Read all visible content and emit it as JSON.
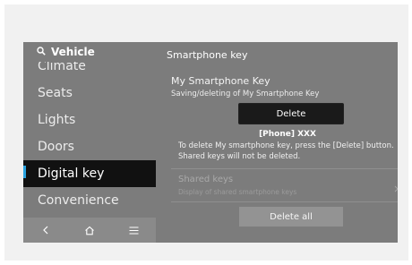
{
  "sidebar": {
    "title": "Vehicle",
    "items": [
      {
        "label": "Climate"
      },
      {
        "label": "Seats"
      },
      {
        "label": "Lights"
      },
      {
        "label": "Doors"
      },
      {
        "label": "Digital key"
      },
      {
        "label": "Convenience"
      }
    ],
    "selected": "Digital key"
  },
  "content": {
    "title": "Smartphone key",
    "key_title": "My Smartphone Key",
    "key_subtitle": "Saving/deleting of My Smartphone Key",
    "delete_label": "Delete",
    "phone_label": "[Phone] XXX",
    "info_line1": "To delete My smartphone key, press the [Delete] button.",
    "info_line2": "Shared keys will not be deleted.",
    "shared_title": "Shared keys",
    "shared_subtitle": "Display of shared smartphone keys",
    "delete_all_label": "Delete all"
  },
  "icons": {
    "search": "search-icon",
    "back": "back-icon",
    "home": "home-icon",
    "menu": "menu-icon",
    "chevron": "chevron-right-icon"
  },
  "colors": {
    "accent": "#2aa3e0",
    "selected_bg": "#111111",
    "screen_bg": "#7c7c7c"
  }
}
